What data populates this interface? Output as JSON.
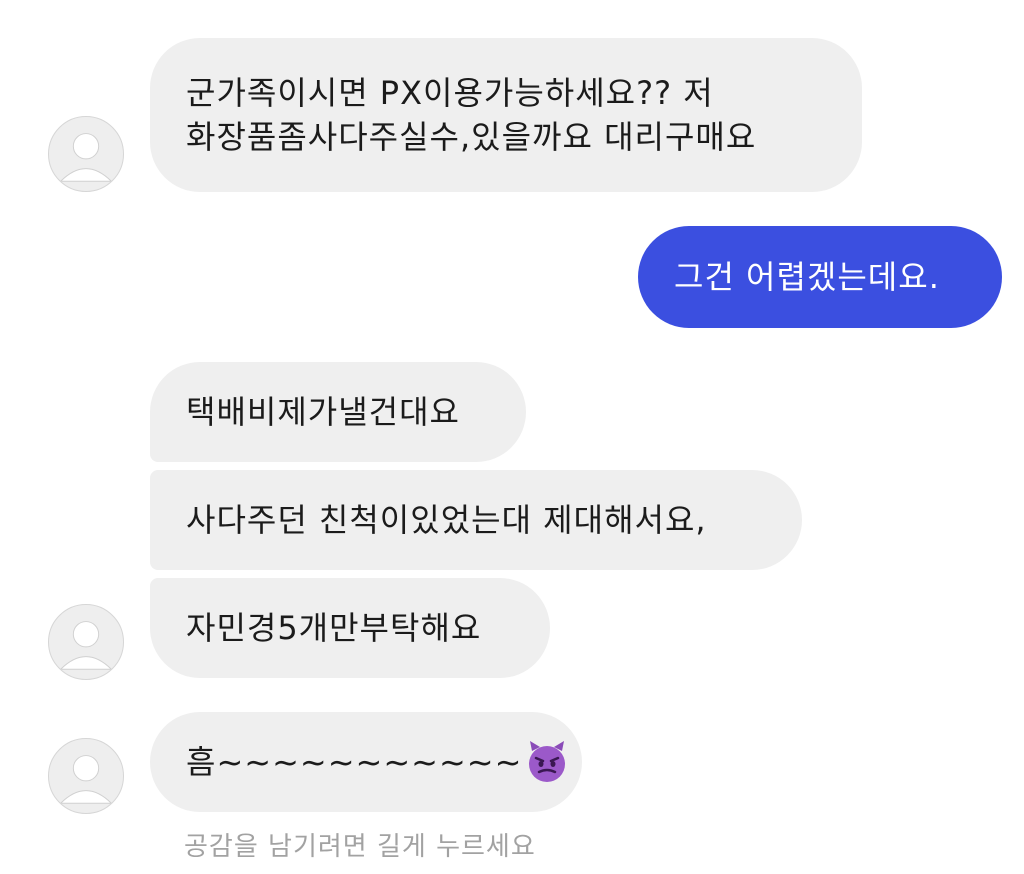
{
  "conversation": {
    "messages": [
      {
        "sender": "other",
        "lines": [
          "군가족이시면 PX이용가능하세요?? 저",
          "화장품좀사다주실수,있을까요 대리구매요"
        ]
      },
      {
        "sender": "me",
        "text": "그건 어렵겠는데요."
      },
      {
        "sender": "other",
        "text": "택배비제가낼건대요"
      },
      {
        "sender": "other",
        "text": "사다주던 친척이있었는대 제대해서요,"
      },
      {
        "sender": "other",
        "text": "자민경5개만부탁해요"
      },
      {
        "sender": "other",
        "text": "흠~~~~~~~~~~~",
        "emoji": "smiling-devil-emoji"
      }
    ],
    "reaction_hint": "공감을 남기려면 길게 누르세요"
  },
  "colors": {
    "incoming_bubble": "#efefef",
    "outgoing_bubble": "#3b4fe0",
    "outgoing_text": "#ffffff",
    "hint_text": "#a2a2a2"
  }
}
